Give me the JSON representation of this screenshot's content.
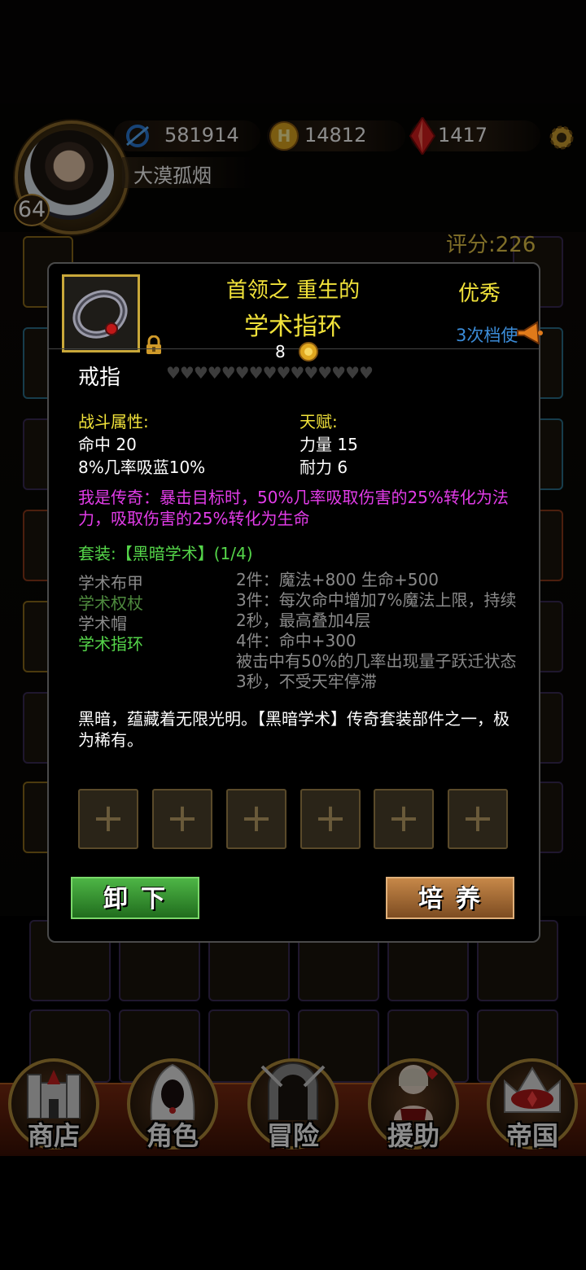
{
  "player": {
    "name": "大漠孤烟",
    "level": "64",
    "exp": "581914",
    "gold": "14812",
    "gems": "1417",
    "score": "评分:226"
  },
  "item": {
    "title_line1": "首领之 重生的",
    "title_line2": "学术指环",
    "quality": "优秀",
    "times": "3次档使",
    "price": "8",
    "type": "戒指",
    "hearts": "♥♥♥♥♥♥♥♥♥♥♥♥♥♥♥",
    "combat_head": "战斗属性:",
    "combat_stats": [
      "命中 20",
      "8%几率吸蓝10%"
    ],
    "talent_head": "天赋:",
    "talent_stats": [
      "力量 15",
      "耐力 6"
    ],
    "legend_effect": "我是传奇：暴击目标时，50%几率吸取伤害的25%转化为法力，吸取伤害的25%转化为生命",
    "set_head": "套装:【黑暗学术】(1/4)",
    "set_pieces": [
      {
        "name": "学术布甲",
        "owned": false
      },
      {
        "name": "学术权杖",
        "owned": false
      },
      {
        "name": "学术帽",
        "owned": false
      },
      {
        "name": "学术指环",
        "owned": true
      }
    ],
    "set_bonuses": [
      "2件：魔法+800 生命+500",
      "3件：每次命中增加7%魔法上限，持续2秒，最高叠加4层",
      "4件：命中+300",
      "被击中有50%的几率出现量子跃迁状态3秒，不受天牢停滞"
    ],
    "description": "黑暗，蕴藏着无限光明。【黑暗学术】传奇套装部件之一，极为稀有。",
    "gem_slot_symbol": "+"
  },
  "buttons": {
    "unequip": "卸下",
    "train": "培养"
  },
  "nav": [
    {
      "label": "商店",
      "icon": "castle-icon"
    },
    {
      "label": "角色",
      "icon": "hooded-figure-icon"
    },
    {
      "label": "冒险",
      "icon": "dungeon-gate-icon"
    },
    {
      "label": "援助",
      "icon": "helper-girl-icon"
    },
    {
      "label": "帝国",
      "icon": "crown-icon"
    }
  ],
  "colors": {
    "title_yellow": "#f1e23a",
    "legend_magenta": "#e23ce8",
    "set_green": "#55d64a",
    "inactive_gray": "#8a8a8a",
    "times_blue": "#3b8cd8"
  }
}
